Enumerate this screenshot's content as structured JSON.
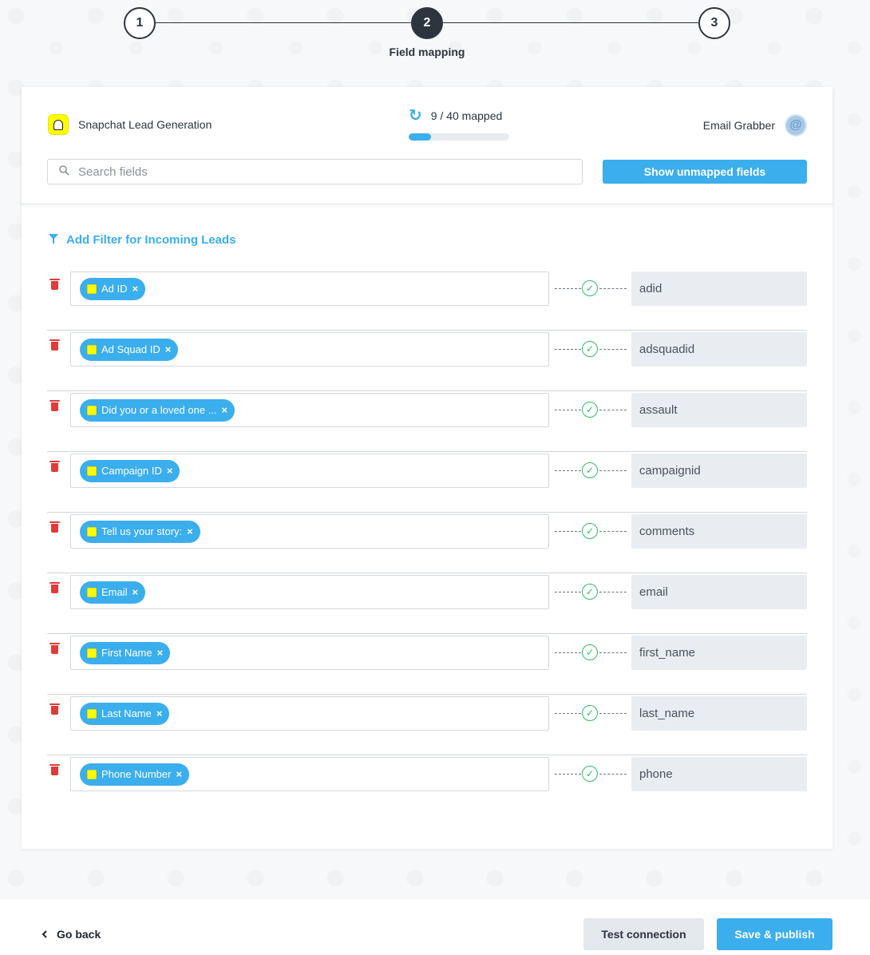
{
  "stepper": {
    "steps": [
      {
        "number": "1",
        "label": ""
      },
      {
        "number": "2",
        "label": "Field mapping"
      },
      {
        "number": "3",
        "label": ""
      }
    ],
    "active_step": 2
  },
  "header": {
    "source_name": "Snapchat Lead Generation",
    "progress_text": "9 / 40 mapped",
    "progress_fraction": 0.225,
    "destination_name": "Email Grabber",
    "destination_logo_letter": "@"
  },
  "search": {
    "placeholder": "Search fields",
    "value": ""
  },
  "show_unmapped_label": "Show unmapped fields",
  "filter_label": "Add Filter for Incoming Leads",
  "mappings": [
    {
      "source": "Ad ID",
      "target": "adid"
    },
    {
      "source": "Ad Squad ID",
      "target": "adsquadid"
    },
    {
      "source": "Did you or a loved one ...",
      "target": "assault"
    },
    {
      "source": "Campaign ID",
      "target": "campaignid"
    },
    {
      "source": "Tell us your story:",
      "target": "comments"
    },
    {
      "source": "Email",
      "target": "email"
    },
    {
      "source": "First Name",
      "target": "first_name"
    },
    {
      "source": "Last Name",
      "target": "last_name"
    },
    {
      "source": "Phone Number",
      "target": "phone"
    }
  ],
  "icons": {
    "chip_close": "×",
    "check": "✓",
    "refresh": "↻",
    "search": "⚲",
    "filter": "▼",
    "back": "‹"
  },
  "footer": {
    "back_label": "Go back",
    "test_label": "Test connection",
    "save_label": "Save & publish"
  },
  "colors": {
    "accent": "#3baeed",
    "dark": "#2c3440",
    "success": "#2ebd6b",
    "danger": "#e03b3b"
  }
}
